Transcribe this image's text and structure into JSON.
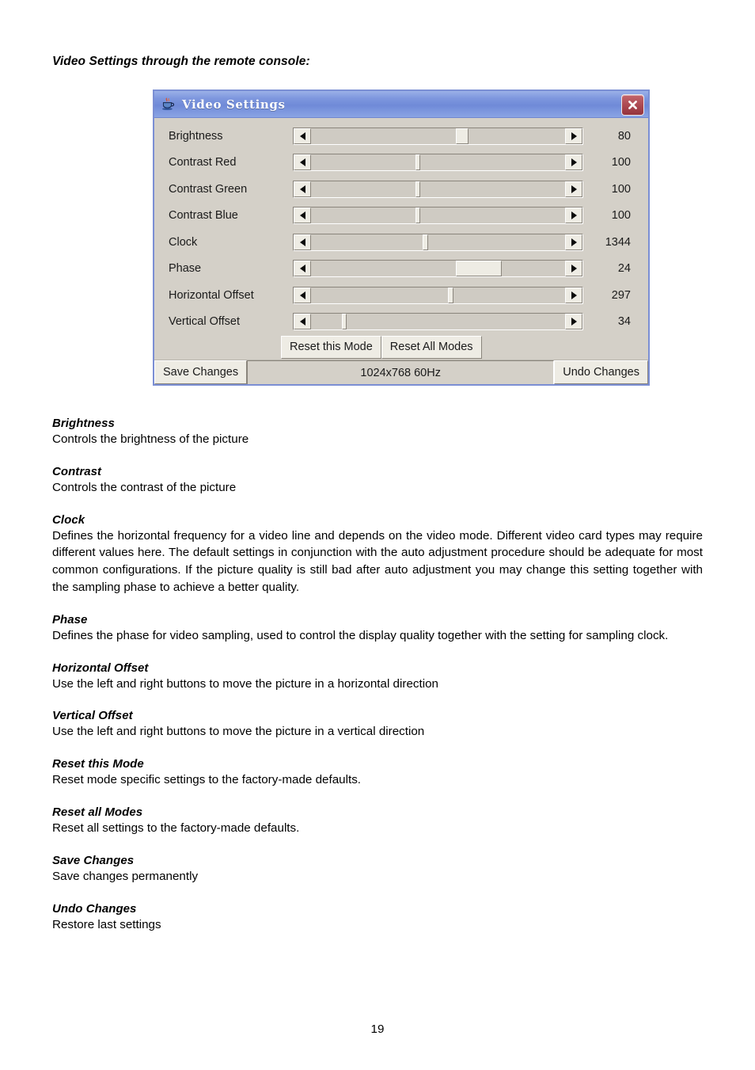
{
  "document": {
    "intro_title": "Video Settings through the remote console:",
    "page_number": "19"
  },
  "dialog": {
    "title": "Video Settings",
    "icon": "java-coffee-cup-icon",
    "close_label": "×",
    "accent_titlebar": "#7e97de",
    "face_color": "#d4d0c8",
    "close_color": "#ab4750",
    "settings": [
      {
        "label": "Brightness",
        "value": "80",
        "thumb_pct": 57,
        "thumb_w": 5
      },
      {
        "label": "Contrast Red",
        "value": "100",
        "thumb_pct": 41,
        "thumb_w": 2
      },
      {
        "label": "Contrast Green",
        "value": "100",
        "thumb_pct": 41,
        "thumb_w": 2
      },
      {
        "label": "Contrast Blue",
        "value": "100",
        "thumb_pct": 41,
        "thumb_w": 2
      },
      {
        "label": "Clock",
        "value": "1344",
        "thumb_pct": 44,
        "thumb_w": 2
      },
      {
        "label": "Phase",
        "value": "24",
        "thumb_pct": 57,
        "thumb_w": 18
      },
      {
        "label": "Horizontal Offset",
        "value": "297",
        "thumb_pct": 54,
        "thumb_w": 2
      },
      {
        "label": "Vertical Offset",
        "value": "34",
        "thumb_pct": 12,
        "thumb_w": 2
      }
    ],
    "buttons": {
      "reset_this_mode": "Reset this Mode",
      "reset_all_modes": "Reset All Modes",
      "save_changes": "Save Changes",
      "undo_changes": "Undo Changes"
    },
    "status": "1024x768 60Hz"
  },
  "sections": [
    {
      "heading": "Brightness",
      "body": "Controls the brightness of the picture",
      "justify": false
    },
    {
      "heading": "Contrast",
      "body": "Controls the contrast of the picture",
      "justify": false
    },
    {
      "heading": "Clock",
      "body": "Defines the horizontal frequency for a video line and depends on the video mode. Different video card types may require different values here. The default settings in conjunction with the auto adjustment procedure should be adequate for most common configurations. If the picture quality is still bad after auto adjustment you may change this setting together with the sampling phase to achieve a better quality.",
      "justify": true
    },
    {
      "heading": "Phase",
      "body": "Defines the phase for video sampling, used to control the display quality together with the setting for sampling clock.",
      "justify": true
    },
    {
      "heading": "Horizontal Offset",
      "body": "Use the left and right buttons to move the picture in a horizontal direction",
      "justify": false
    },
    {
      "heading": "Vertical Offset",
      "body": "Use the left and right buttons to move the picture in a vertical direction",
      "justify": false
    },
    {
      "heading": "Reset this Mode",
      "body": "Reset mode specific settings to the factory-made defaults.",
      "justify": false
    },
    {
      "heading": "Reset all Modes",
      "body": "Reset all settings to the factory-made defaults.",
      "justify": false
    },
    {
      "heading": "Save Changes",
      "body": "Save changes permanently",
      "justify": false
    },
    {
      "heading": "Undo Changes",
      "body": "Restore last settings",
      "justify": false
    }
  ]
}
